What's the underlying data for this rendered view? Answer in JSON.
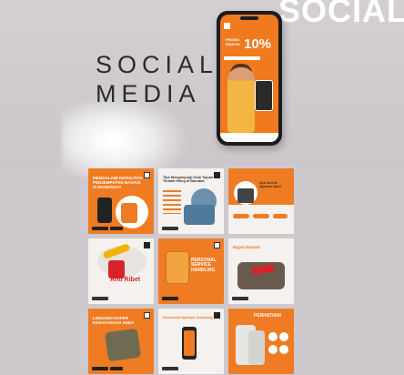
{
  "hero": {
    "bg_word": "SOCIAL",
    "title_line1": "SOCIAL",
    "title_line2": "MEDIA"
  },
  "phone": {
    "promo_label": "PROMO DISKON",
    "promo_value": "10%"
  },
  "posts": [
    {
      "style": "orange",
      "headline": "Mengalami Kesulitan Penjemputan Bagasi di Bandara?"
    },
    {
      "style": "white",
      "headline": "Tips Mengunjungi Kota Tujuan Terbaik Hiling di Bandara"
    },
    {
      "style": "white",
      "headline": "Ayo ikut ke layanan kami"
    },
    {
      "style": "white",
      "headline": "Anti Ribet"
    },
    {
      "style": "orange",
      "headline": "Personal Service Handling"
    },
    {
      "style": "white",
      "headline": "Bagasi Banyak"
    },
    {
      "style": "orange",
      "headline": "Lindungi Koper Kesayangan Anda"
    },
    {
      "style": "white",
      "headline": "Download Aplikasi Sekarang"
    },
    {
      "style": "white",
      "headline": "Perhatian!"
    }
  ],
  "colors": {
    "brand_orange": "#ef7b22",
    "background": "#c9c5c8",
    "text_dark": "#2b2b2b"
  }
}
